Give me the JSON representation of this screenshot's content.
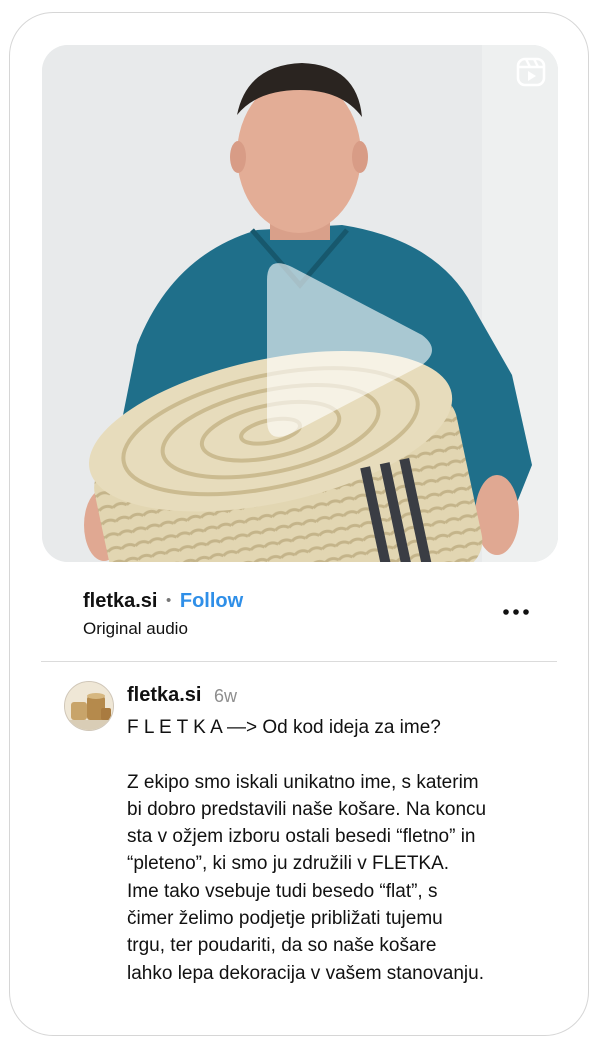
{
  "post": {
    "username": "fletka.si",
    "separator": "•",
    "follow_label": "Follow",
    "audio_label": "Original audio",
    "more_icon": "more-horizontal-icon",
    "media_type_icon": "reels-icon",
    "play_icon": "play-icon"
  },
  "comment": {
    "username": "fletka.si",
    "time": "6w",
    "text": "F L E T K A —> Od kod ideja za ime?\n\nZ ekipo smo iskali unikatno ime, s katerim\nbi dobro predstavili naše košare. Na koncu\nsta v ožjem izboru ostali besedi “fletno” in\n“pleteno”, ki smo ju združili v FLETKA.\nIme tako vsebuje tudi besedo “flat”, s\nčimer želimo podjetje približati tujemu\ntrgu, ter poudariti, da so naše košare\nlahko lepa dekoracija v vašem stanovanju."
  },
  "colors": {
    "accent": "#2f8fe8",
    "muted": "#8e8e8e",
    "shirt": "#1f6f8a",
    "basket": "#ddd0a8"
  }
}
